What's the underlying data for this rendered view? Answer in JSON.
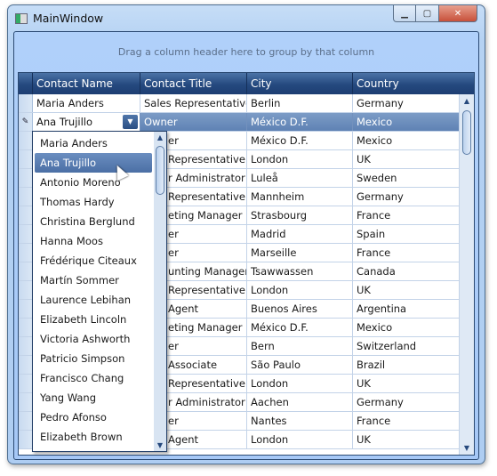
{
  "window": {
    "title": "MainWindow",
    "minimize": "▁",
    "maximize": "▢",
    "close": "✕"
  },
  "group_panel": {
    "text": "Drag a column header here to group by that column"
  },
  "columns": [
    "Contact Name",
    "Contact Title",
    "City",
    "Country"
  ],
  "rows": [
    {
      "indicator": "",
      "name": "Maria Anders",
      "title": "Sales Representative",
      "city": "Berlin",
      "country": "Germany"
    },
    {
      "indicator": "✎",
      "name": "Ana Trujillo",
      "title": "Owner",
      "city": "México D.F.",
      "country": "Mexico"
    }
  ],
  "occluded_rows": [
    {
      "title": "er",
      "city": "México D.F.",
      "country": "Mexico"
    },
    {
      "title": "Representative",
      "city": "London",
      "country": "UK"
    },
    {
      "title": "r Administrator",
      "city": "Luleå",
      "country": "Sweden"
    },
    {
      "title": "Representative",
      "city": "Mannheim",
      "country": "Germany"
    },
    {
      "title": "eting Manager",
      "city": "Strasbourg",
      "country": "France"
    },
    {
      "title": "er",
      "city": "Madrid",
      "country": "Spain"
    },
    {
      "title": "er",
      "city": "Marseille",
      "country": "France"
    },
    {
      "title": "unting Manager",
      "city": "Tsawwassen",
      "country": "Canada"
    },
    {
      "title": "Representative",
      "city": "London",
      "country": "UK"
    },
    {
      "title": "Agent",
      "city": "Buenos Aires",
      "country": "Argentina"
    },
    {
      "title": "eting Manager",
      "city": "México D.F.",
      "country": "Mexico"
    },
    {
      "title": "er",
      "city": "Bern",
      "country": "Switzerland"
    },
    {
      "title": "Associate",
      "city": "São Paulo",
      "country": "Brazil"
    },
    {
      "title": "Representative",
      "city": "London",
      "country": "UK"
    },
    {
      "title": "r Administrator",
      "city": "Aachen",
      "country": "Germany"
    },
    {
      "title": "er",
      "city": "Nantes",
      "country": "France"
    },
    {
      "title": "Agent",
      "city": "London",
      "country": "UK"
    }
  ],
  "dropdown": {
    "selected": "Ana Trujillo",
    "items": [
      "Maria Anders",
      "Ana Trujillo",
      "Antonio Moreno",
      "Thomas Hardy",
      "Christina Berglund",
      "Hanna Moos",
      "Frédérique Citeaux",
      "Martín Sommer",
      "Laurence Lebihan",
      "Elizabeth Lincoln",
      "Victoria Ashworth",
      "Patricio Simpson",
      "Francisco Chang",
      "Yang Wang",
      "Pedro Afonso",
      "Elizabeth Brown"
    ]
  },
  "icons": {
    "dropdown_arrow": "▼",
    "scroll_up": "▲",
    "scroll_down": "▼"
  }
}
